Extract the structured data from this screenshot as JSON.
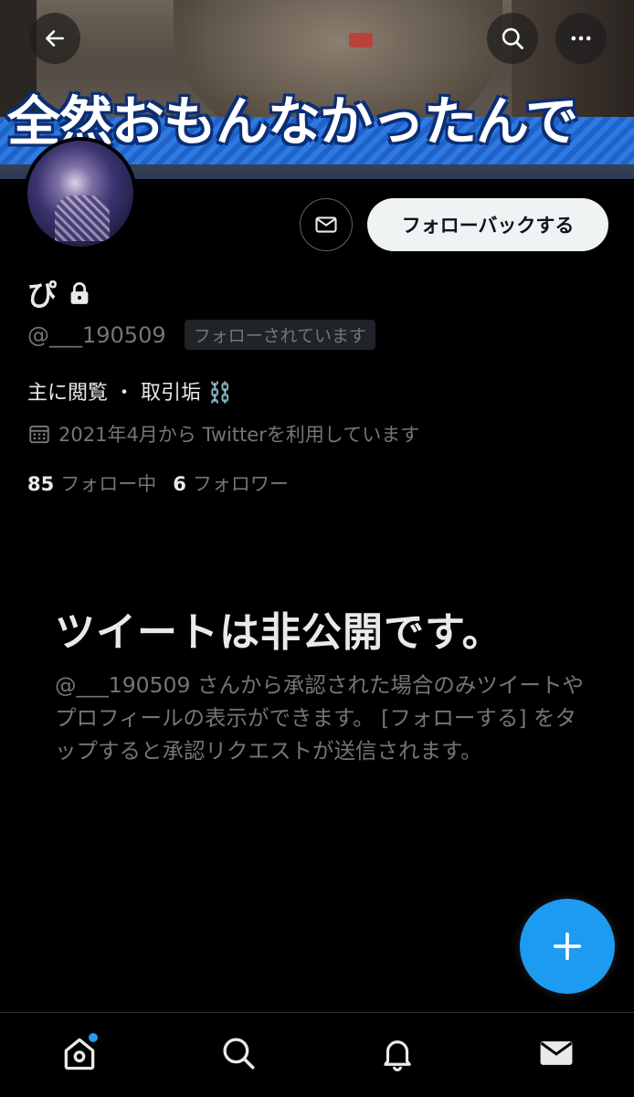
{
  "header": {
    "banner_caption": "全然おもんなかったんで",
    "back_icon": "arrow-left-icon",
    "search_icon": "search-icon",
    "more_icon": "ellipsis-icon"
  },
  "profile": {
    "display_name": "ぴ",
    "protected_icon": "lock-icon",
    "handle": "@___190509",
    "follows_you": "フォローされています",
    "bio": "主に閲覧 ・ 取引垢 ⛓️",
    "joined": "2021年4月から Twitterを利用しています",
    "following_count": "85",
    "following_label": "フォロー中",
    "followers_count": "6",
    "followers_label": "フォロワー"
  },
  "actions": {
    "message_icon": "envelope-icon",
    "follow_back_label": "フォローバックする"
  },
  "private_notice": {
    "title": "ツイートは非公開です。",
    "body": "@___190509 さんから承認された場合のみツイートやプロフィールの表示ができます。 [フォローする] をタップすると承認リクエストが送信されます。"
  },
  "fab": {
    "icon": "plus-icon"
  },
  "tabbar": {
    "items": [
      "home-icon",
      "search-icon",
      "notifications-icon",
      "messages-icon"
    ],
    "home_has_new": true
  },
  "colors": {
    "accent": "#1d9bf0",
    "background": "#000000",
    "secondary_text": "#71767b"
  }
}
